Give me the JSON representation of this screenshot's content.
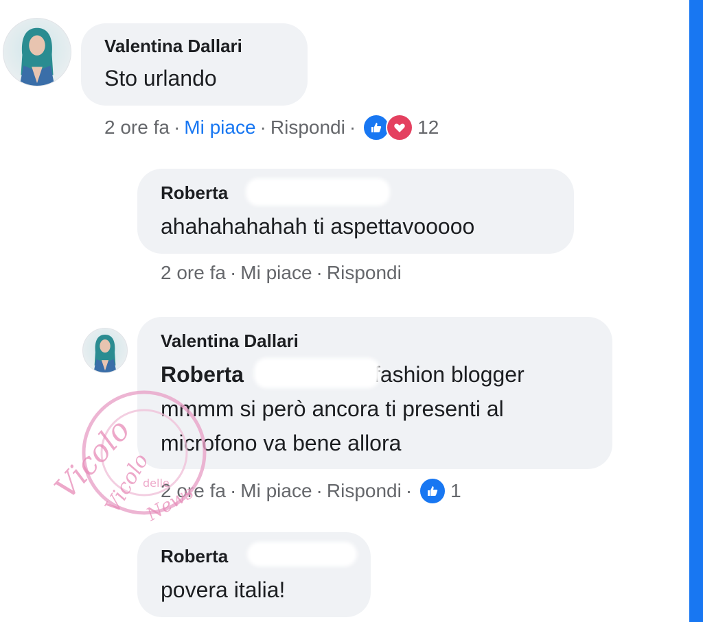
{
  "comments": [
    {
      "name": "Valentina Dallari",
      "text": "Sto urlando",
      "meta": {
        "time": "2 ore fa",
        "like": "Mi piace",
        "reply": "Rispondi",
        "reactions": [
          "like-icon",
          "heart-icon"
        ],
        "count": "12"
      }
    },
    {
      "name": "Roberta",
      "text": "ahahahahahah ti aspettavooooo",
      "meta": {
        "time": "2 ore fa",
        "like": "Mi piace",
        "reply": "Rispondi"
      }
    },
    {
      "name": "Valentina Dallari",
      "mention": "Roberta",
      "line1_rest": "fashion blogger",
      "line2": "mmmm si però ancora ti presenti al",
      "line3": "microfono va bene allora",
      "meta": {
        "time": "2 ore fa",
        "like": "Mi piace",
        "reply": "Rispondi",
        "reactions": [
          "like-icon"
        ],
        "count": "1"
      }
    },
    {
      "name": "Roberta",
      "text": "povera italia!"
    }
  ],
  "watermark": {
    "l1": "Vicolo",
    "l2": "delle",
    "l3": "News"
  },
  "colors": {
    "accent": "#1877f2",
    "bubble": "#f0f2f5",
    "meta": "#65676b",
    "heart": "#e4405f"
  }
}
